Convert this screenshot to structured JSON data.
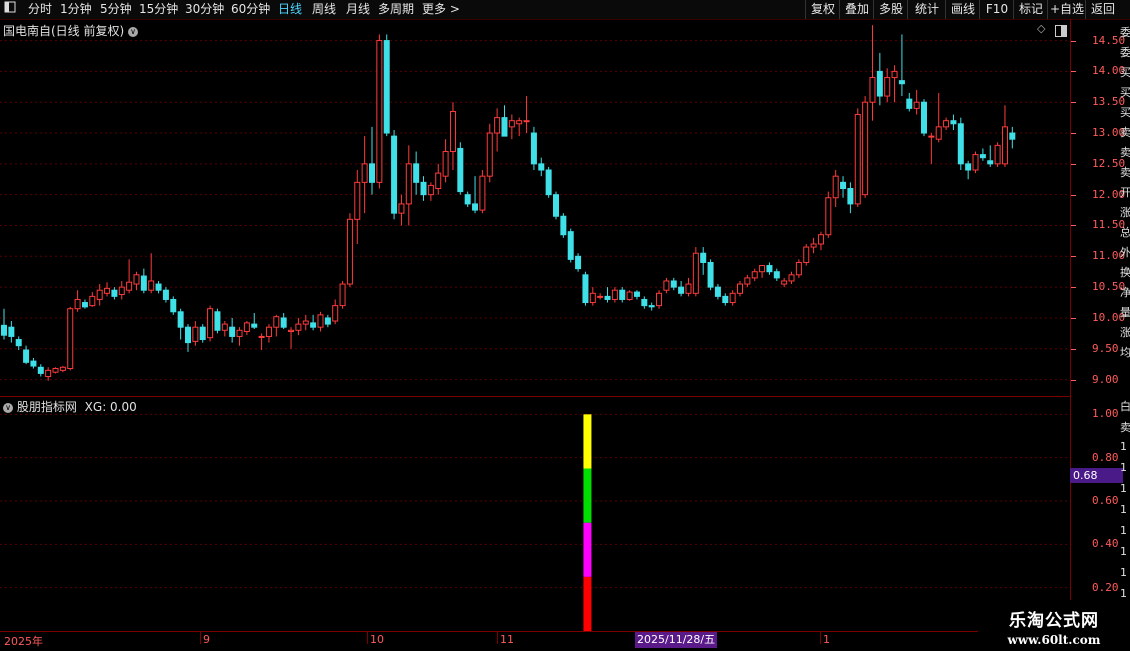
{
  "toolbar": {
    "left_items": [
      "分时",
      "1分钟",
      "5分钟",
      "15分钟",
      "30分钟",
      "60分钟",
      "日线",
      "周线",
      "月线",
      "多周期",
      "更多"
    ],
    "active": "日线",
    "right_items": [
      "复权",
      "叠加",
      "多股",
      "统计",
      "画线",
      "F10",
      "标记",
      "+自选",
      "返回"
    ]
  },
  "main_panel": {
    "title": "国电南自(日线 前复权)"
  },
  "indicator_panel": {
    "title": "股朋指标网",
    "value_text": "XG: 0.00"
  },
  "price_axis": [
    "14.50",
    "14.00",
    "13.50",
    "13.00",
    "12.50",
    "12.00",
    "11.50",
    "11.00",
    "10.50",
    "10.00",
    "9.50",
    "9.00"
  ],
  "indicator_axis": [
    "1.00",
    "0.80",
    "0.60",
    "0.40",
    "0.20"
  ],
  "indicator_value_tag": "0.68",
  "date_axis": [
    "2025年",
    "9",
    "10",
    "11",
    "1"
  ],
  "cursor_date": "2025/11/28/五",
  "side_chars": [
    "委",
    "委",
    "买",
    "买",
    "买",
    "卖",
    "卖",
    "卖",
    "开",
    "涨",
    "总",
    "外",
    "换",
    "净",
    "量",
    "涨",
    "均"
  ],
  "side_chars_lower": [
    "白",
    "卖",
    "1",
    "1",
    "1",
    "1",
    "1",
    "1",
    "1",
    "1"
  ],
  "watermark": {
    "title": "乐淘公式网",
    "url": "www.60lt.com"
  },
  "colors": {
    "up": "#ff3b3b",
    "down": "#3fe0e8",
    "signal_red": "#ff0000",
    "signal_magenta": "#ff00ff",
    "signal_green": "#00e000",
    "signal_yellow": "#ffff00"
  },
  "chart_data": {
    "type": "candlestick",
    "ylim": [
      8.75,
      14.85
    ],
    "candles": [
      {
        "o": 9.88,
        "h": 10.15,
        "l": 9.65,
        "c": 9.72
      },
      {
        "o": 9.85,
        "h": 9.95,
        "l": 9.6,
        "c": 9.7
      },
      {
        "o": 9.65,
        "h": 9.7,
        "l": 9.48,
        "c": 9.55
      },
      {
        "o": 9.48,
        "h": 9.55,
        "l": 9.25,
        "c": 9.28
      },
      {
        "o": 9.3,
        "h": 9.35,
        "l": 9.18,
        "c": 9.22
      },
      {
        "o": 9.2,
        "h": 9.25,
        "l": 9.05,
        "c": 9.1
      },
      {
        "o": 9.05,
        "h": 9.2,
        "l": 8.98,
        "c": 9.15
      },
      {
        "o": 9.12,
        "h": 9.2,
        "l": 9.1,
        "c": 9.18
      },
      {
        "o": 9.15,
        "h": 9.22,
        "l": 9.12,
        "c": 9.2
      },
      {
        "o": 9.18,
        "h": 10.18,
        "l": 9.15,
        "c": 10.15
      },
      {
        "o": 10.15,
        "h": 10.45,
        "l": 10.1,
        "c": 10.3
      },
      {
        "o": 10.25,
        "h": 10.3,
        "l": 10.15,
        "c": 10.18
      },
      {
        "o": 10.2,
        "h": 10.42,
        "l": 10.18,
        "c": 10.35
      },
      {
        "o": 10.3,
        "h": 10.55,
        "l": 10.2,
        "c": 10.45
      },
      {
        "o": 10.4,
        "h": 10.58,
        "l": 10.35,
        "c": 10.48
      },
      {
        "o": 10.45,
        "h": 10.5,
        "l": 10.3,
        "c": 10.35
      },
      {
        "o": 10.38,
        "h": 10.6,
        "l": 10.3,
        "c": 10.5
      },
      {
        "o": 10.45,
        "h": 10.95,
        "l": 10.4,
        "c": 10.58
      },
      {
        "o": 10.55,
        "h": 10.75,
        "l": 10.45,
        "c": 10.7
      },
      {
        "o": 10.68,
        "h": 10.8,
        "l": 10.4,
        "c": 10.45
      },
      {
        "o": 10.45,
        "h": 11.05,
        "l": 10.4,
        "c": 10.6
      },
      {
        "o": 10.55,
        "h": 10.6,
        "l": 10.4,
        "c": 10.45
      },
      {
        "o": 10.45,
        "h": 10.5,
        "l": 10.25,
        "c": 10.3
      },
      {
        "o": 10.3,
        "h": 10.35,
        "l": 10.05,
        "c": 10.1
      },
      {
        "o": 10.1,
        "h": 10.15,
        "l": 9.65,
        "c": 9.85
      },
      {
        "o": 9.85,
        "h": 9.9,
        "l": 9.45,
        "c": 9.6
      },
      {
        "o": 9.62,
        "h": 9.95,
        "l": 9.55,
        "c": 9.85
      },
      {
        "o": 9.85,
        "h": 9.9,
        "l": 9.6,
        "c": 9.65
      },
      {
        "o": 9.68,
        "h": 10.2,
        "l": 9.62,
        "c": 10.15
      },
      {
        "o": 10.1,
        "h": 10.15,
        "l": 9.75,
        "c": 9.8
      },
      {
        "o": 9.8,
        "h": 9.95,
        "l": 9.7,
        "c": 9.9
      },
      {
        "o": 9.85,
        "h": 10.0,
        "l": 9.6,
        "c": 9.7
      },
      {
        "o": 9.7,
        "h": 9.85,
        "l": 9.55,
        "c": 9.8
      },
      {
        "o": 9.78,
        "h": 9.95,
        "l": 9.72,
        "c": 9.92
      },
      {
        "o": 9.9,
        "h": 10.08,
        "l": 9.82,
        "c": 9.85
      },
      {
        "o": 9.7,
        "h": 9.75,
        "l": 9.48,
        "c": 9.7
      },
      {
        "o": 9.7,
        "h": 9.9,
        "l": 9.6,
        "c": 9.85
      },
      {
        "o": 9.85,
        "h": 10.05,
        "l": 9.7,
        "c": 10.02
      },
      {
        "o": 10.0,
        "h": 10.08,
        "l": 9.82,
        "c": 9.85
      },
      {
        "o": 9.78,
        "h": 9.85,
        "l": 9.5,
        "c": 9.8
      },
      {
        "o": 9.8,
        "h": 10.0,
        "l": 9.72,
        "c": 9.9
      },
      {
        "o": 9.9,
        "h": 10.05,
        "l": 9.8,
        "c": 9.95
      },
      {
        "o": 9.92,
        "h": 10.05,
        "l": 9.8,
        "c": 9.85
      },
      {
        "o": 9.85,
        "h": 10.1,
        "l": 9.78,
        "c": 10.05
      },
      {
        "o": 10.0,
        "h": 10.05,
        "l": 9.85,
        "c": 9.9
      },
      {
        "o": 9.95,
        "h": 10.3,
        "l": 9.9,
        "c": 10.2
      },
      {
        "o": 10.2,
        "h": 10.6,
        "l": 10.15,
        "c": 10.55
      },
      {
        "o": 10.55,
        "h": 11.7,
        "l": 10.5,
        "c": 11.6
      },
      {
        "o": 11.6,
        "h": 12.4,
        "l": 11.2,
        "c": 12.2
      },
      {
        "o": 12.2,
        "h": 12.95,
        "l": 11.7,
        "c": 12.5
      },
      {
        "o": 12.5,
        "h": 13.1,
        "l": 12.0,
        "c": 12.2
      },
      {
        "o": 12.2,
        "h": 14.6,
        "l": 12.1,
        "c": 14.5
      },
      {
        "o": 14.5,
        "h": 14.6,
        "l": 12.95,
        "c": 13.0
      },
      {
        "o": 12.95,
        "h": 13.05,
        "l": 11.6,
        "c": 11.7
      },
      {
        "o": 11.7,
        "h": 12.0,
        "l": 11.5,
        "c": 11.85
      },
      {
        "o": 11.85,
        "h": 12.8,
        "l": 11.5,
        "c": 12.5
      },
      {
        "o": 12.5,
        "h": 12.7,
        "l": 12.0,
        "c": 12.2
      },
      {
        "o": 12.2,
        "h": 12.3,
        "l": 11.9,
        "c": 12.0
      },
      {
        "o": 12.0,
        "h": 12.2,
        "l": 11.9,
        "c": 12.15
      },
      {
        "o": 12.1,
        "h": 12.5,
        "l": 12.0,
        "c": 12.35
      },
      {
        "o": 12.3,
        "h": 12.9,
        "l": 12.2,
        "c": 12.7
      },
      {
        "o": 12.7,
        "h": 13.5,
        "l": 12.4,
        "c": 13.35
      },
      {
        "o": 12.75,
        "h": 12.85,
        "l": 12.0,
        "c": 12.05
      },
      {
        "o": 12.0,
        "h": 12.05,
        "l": 11.8,
        "c": 11.85
      },
      {
        "o": 11.85,
        "h": 12.3,
        "l": 11.7,
        "c": 11.75
      },
      {
        "o": 11.75,
        "h": 12.4,
        "l": 11.7,
        "c": 12.3
      },
      {
        "o": 12.3,
        "h": 13.15,
        "l": 12.2,
        "c": 13.0
      },
      {
        "o": 13.0,
        "h": 13.4,
        "l": 12.7,
        "c": 13.25
      },
      {
        "o": 13.25,
        "h": 13.45,
        "l": 13.0,
        "c": 12.95
      },
      {
        "o": 13.1,
        "h": 13.3,
        "l": 12.9,
        "c": 13.2
      },
      {
        "o": 13.15,
        "h": 13.25,
        "l": 12.95,
        "c": 13.2
      },
      {
        "o": 13.2,
        "h": 13.6,
        "l": 13.0,
        "c": 13.2
      },
      {
        "o": 13.0,
        "h": 13.1,
        "l": 12.4,
        "c": 12.5
      },
      {
        "o": 12.5,
        "h": 12.6,
        "l": 12.3,
        "c": 12.4
      },
      {
        "o": 12.4,
        "h": 12.45,
        "l": 11.95,
        "c": 12.0
      },
      {
        "o": 12.0,
        "h": 12.05,
        "l": 11.6,
        "c": 11.65
      },
      {
        "o": 11.65,
        "h": 11.7,
        "l": 11.3,
        "c": 11.35
      },
      {
        "o": 11.4,
        "h": 11.45,
        "l": 10.9,
        "c": 10.95
      },
      {
        "o": 11.0,
        "h": 11.05,
        "l": 10.75,
        "c": 10.8
      },
      {
        "o": 10.7,
        "h": 10.75,
        "l": 10.2,
        "c": 10.25
      },
      {
        "o": 10.25,
        "h": 10.5,
        "l": 10.2,
        "c": 10.4
      },
      {
        "o": 10.35,
        "h": 10.4,
        "l": 10.3,
        "c": 10.35
      },
      {
        "o": 10.35,
        "h": 10.5,
        "l": 10.25,
        "c": 10.3
      },
      {
        "o": 10.3,
        "h": 10.5,
        "l": 10.25,
        "c": 10.45
      },
      {
        "o": 10.45,
        "h": 10.5,
        "l": 10.25,
        "c": 10.3
      },
      {
        "o": 10.3,
        "h": 10.45,
        "l": 10.28,
        "c": 10.42
      },
      {
        "o": 10.42,
        "h": 10.45,
        "l": 10.3,
        "c": 10.35
      },
      {
        "o": 10.3,
        "h": 10.35,
        "l": 10.15,
        "c": 10.2
      },
      {
        "o": 10.2,
        "h": 10.25,
        "l": 10.12,
        "c": 10.18
      },
      {
        "o": 10.2,
        "h": 10.45,
        "l": 10.15,
        "c": 10.4
      },
      {
        "o": 10.45,
        "h": 10.65,
        "l": 10.4,
        "c": 10.6
      },
      {
        "o": 10.6,
        "h": 10.65,
        "l": 10.45,
        "c": 10.5
      },
      {
        "o": 10.5,
        "h": 10.6,
        "l": 10.35,
        "c": 10.4
      },
      {
        "o": 10.4,
        "h": 10.65,
        "l": 10.35,
        "c": 10.55
      },
      {
        "o": 10.4,
        "h": 11.15,
        "l": 10.35,
        "c": 11.05
      },
      {
        "o": 11.05,
        "h": 11.15,
        "l": 10.7,
        "c": 10.9
      },
      {
        "o": 10.9,
        "h": 10.95,
        "l": 10.45,
        "c": 10.5
      },
      {
        "o": 10.5,
        "h": 10.55,
        "l": 10.3,
        "c": 10.35
      },
      {
        "o": 10.35,
        "h": 10.4,
        "l": 10.2,
        "c": 10.25
      },
      {
        "o": 10.25,
        "h": 10.45,
        "l": 10.2,
        "c": 10.4
      },
      {
        "o": 10.4,
        "h": 10.6,
        "l": 10.35,
        "c": 10.55
      },
      {
        "o": 10.55,
        "h": 10.7,
        "l": 10.5,
        "c": 10.65
      },
      {
        "o": 10.65,
        "h": 10.8,
        "l": 10.6,
        "c": 10.75
      },
      {
        "o": 10.75,
        "h": 10.85,
        "l": 10.65,
        "c": 10.85
      },
      {
        "o": 10.85,
        "h": 10.9,
        "l": 10.7,
        "c": 10.75
      },
      {
        "o": 10.75,
        "h": 10.8,
        "l": 10.6,
        "c": 10.65
      },
      {
        "o": 10.55,
        "h": 10.65,
        "l": 10.5,
        "c": 10.6
      },
      {
        "o": 10.6,
        "h": 10.75,
        "l": 10.55,
        "c": 10.7
      },
      {
        "o": 10.7,
        "h": 10.95,
        "l": 10.65,
        "c": 10.9
      },
      {
        "o": 10.9,
        "h": 11.2,
        "l": 10.85,
        "c": 11.15
      },
      {
        "o": 11.15,
        "h": 11.3,
        "l": 11.05,
        "c": 11.2
      },
      {
        "o": 11.2,
        "h": 11.4,
        "l": 11.1,
        "c": 11.35
      },
      {
        "o": 11.35,
        "h": 12.05,
        "l": 11.3,
        "c": 11.95
      },
      {
        "o": 11.95,
        "h": 12.4,
        "l": 11.8,
        "c": 12.3
      },
      {
        "o": 12.2,
        "h": 12.3,
        "l": 11.95,
        "c": 12.1
      },
      {
        "o": 12.1,
        "h": 12.2,
        "l": 11.7,
        "c": 11.85
      },
      {
        "o": 11.85,
        "h": 13.4,
        "l": 11.8,
        "c": 13.3
      },
      {
        "o": 12.0,
        "h": 13.6,
        "l": 11.95,
        "c": 13.5
      },
      {
        "o": 13.5,
        "h": 14.75,
        "l": 13.2,
        "c": 13.9
      },
      {
        "o": 14.0,
        "h": 14.3,
        "l": 13.45,
        "c": 13.6
      },
      {
        "o": 13.6,
        "h": 14.05,
        "l": 13.5,
        "c": 13.9
      },
      {
        "o": 13.9,
        "h": 14.1,
        "l": 13.5,
        "c": 14.0
      },
      {
        "o": 13.85,
        "h": 14.6,
        "l": 13.6,
        "c": 13.8
      },
      {
        "o": 13.55,
        "h": 13.65,
        "l": 13.35,
        "c": 13.4
      },
      {
        "o": 13.4,
        "h": 13.7,
        "l": 13.3,
        "c": 13.5
      },
      {
        "o": 13.5,
        "h": 13.55,
        "l": 12.95,
        "c": 13.0
      },
      {
        "o": 12.95,
        "h": 13.0,
        "l": 12.5,
        "c": 12.95
      },
      {
        "o": 12.9,
        "h": 13.65,
        "l": 12.85,
        "c": 13.1
      },
      {
        "o": 13.1,
        "h": 13.25,
        "l": 13.05,
        "c": 13.2
      },
      {
        "o": 13.2,
        "h": 13.3,
        "l": 13.05,
        "c": 13.15
      },
      {
        "o": 13.15,
        "h": 13.25,
        "l": 12.4,
        "c": 12.5
      },
      {
        "o": 12.5,
        "h": 12.55,
        "l": 12.25,
        "c": 12.4
      },
      {
        "o": 12.4,
        "h": 12.7,
        "l": 12.35,
        "c": 12.65
      },
      {
        "o": 12.65,
        "h": 12.75,
        "l": 12.55,
        "c": 12.6
      },
      {
        "o": 12.55,
        "h": 12.8,
        "l": 12.45,
        "c": 12.5
      },
      {
        "o": 12.5,
        "h": 12.85,
        "l": 12.45,
        "c": 12.8
      },
      {
        "o": 12.5,
        "h": 13.45,
        "l": 12.45,
        "c": 13.1
      },
      {
        "o": 13.0,
        "h": 13.1,
        "l": 12.75,
        "c": 12.9
      }
    ],
    "indicator": {
      "ylim": [
        0,
        1.08
      ],
      "bar_index": 79,
      "segments": [
        {
          "from": 0.0,
          "to": 0.25,
          "color": "#ff0000"
        },
        {
          "from": 0.25,
          "to": 0.5,
          "color": "#ff00ff"
        },
        {
          "from": 0.5,
          "to": 0.75,
          "color": "#00e000"
        },
        {
          "from": 0.75,
          "to": 1.0,
          "color": "#ffff00"
        }
      ]
    }
  }
}
